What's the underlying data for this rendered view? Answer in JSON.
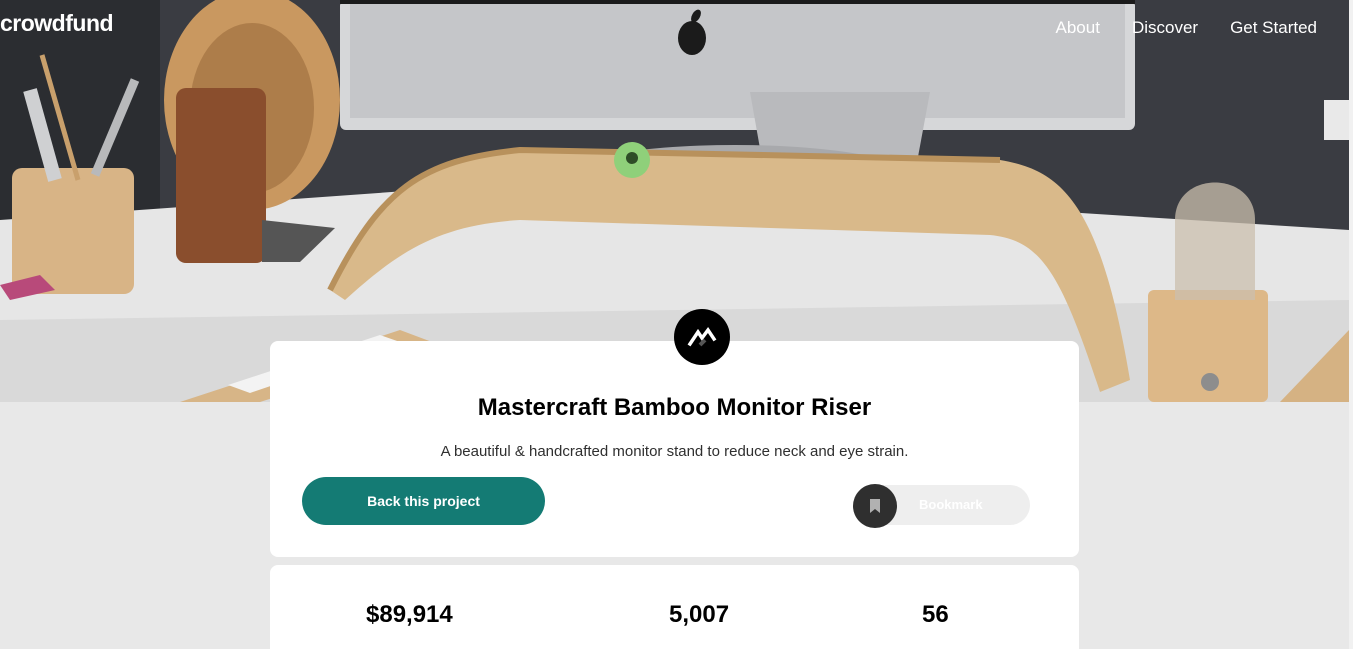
{
  "header": {
    "logo": "crowdfund",
    "nav": [
      {
        "label": "About"
      },
      {
        "label": "Discover"
      },
      {
        "label": "Get Started"
      }
    ]
  },
  "project": {
    "logo_icon": "mastercraft-logo-icon",
    "title": "Mastercraft Bamboo Monitor Riser",
    "description": "A beautiful & handcrafted monitor stand to reduce neck and eye strain.",
    "back_label": "Back this project",
    "bookmark_label": "Bookmark",
    "bookmark_icon": "bookmark-icon"
  },
  "stats": {
    "backed_amount": "$89,914",
    "total_backers": "5,007",
    "days_left": "56"
  },
  "colors": {
    "accent": "#147b74",
    "background": "#e8e8e8",
    "dark": "#2f2f2f"
  }
}
